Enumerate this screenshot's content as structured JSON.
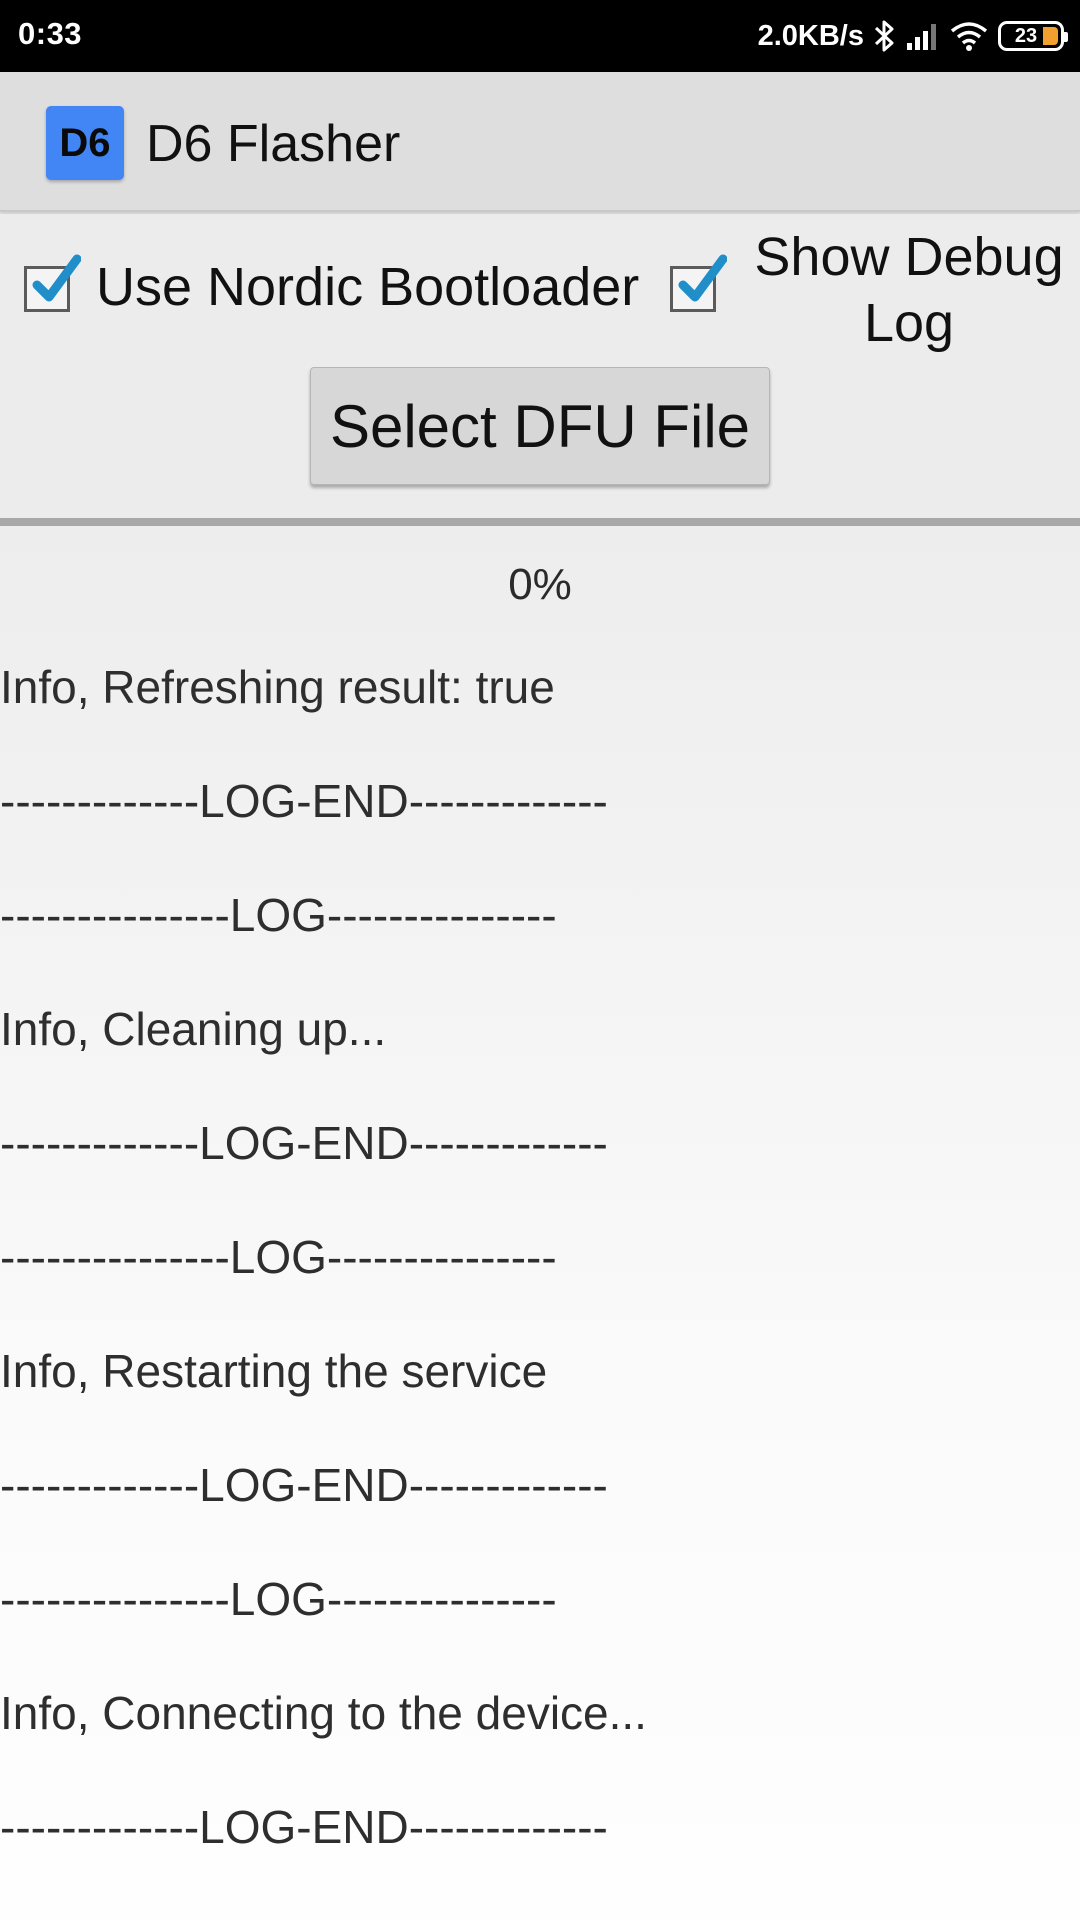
{
  "status_bar": {
    "time": "0:33",
    "net_speed": "2.0KB/s",
    "battery": "23"
  },
  "app": {
    "icon_text": "D6",
    "title": "D6 Flasher"
  },
  "options": {
    "nordic_bootloader": {
      "label": "Use Nordic Bootloader",
      "checked": true
    },
    "debug_log": {
      "label_line1": "Show Debug",
      "label_line2": "Log",
      "checked": true
    }
  },
  "select_button": "Select DFU File",
  "progress": {
    "value": 0,
    "label": "0%"
  },
  "log_lines": [
    "Info, Refreshing result: true",
    "-------------LOG-END-------------",
    "---------------LOG---------------",
    "Info, Cleaning up...",
    "-------------LOG-END-------------",
    "---------------LOG---------------",
    "Info, Restarting the service",
    "-------------LOG-END-------------",
    "---------------LOG---------------",
    "Info, Connecting to the device...",
    "-------------LOG-END-------------"
  ],
  "colors": {
    "accent": "#33b5e5",
    "app_icon": "#4285f4",
    "battery": "#f2a12e"
  }
}
